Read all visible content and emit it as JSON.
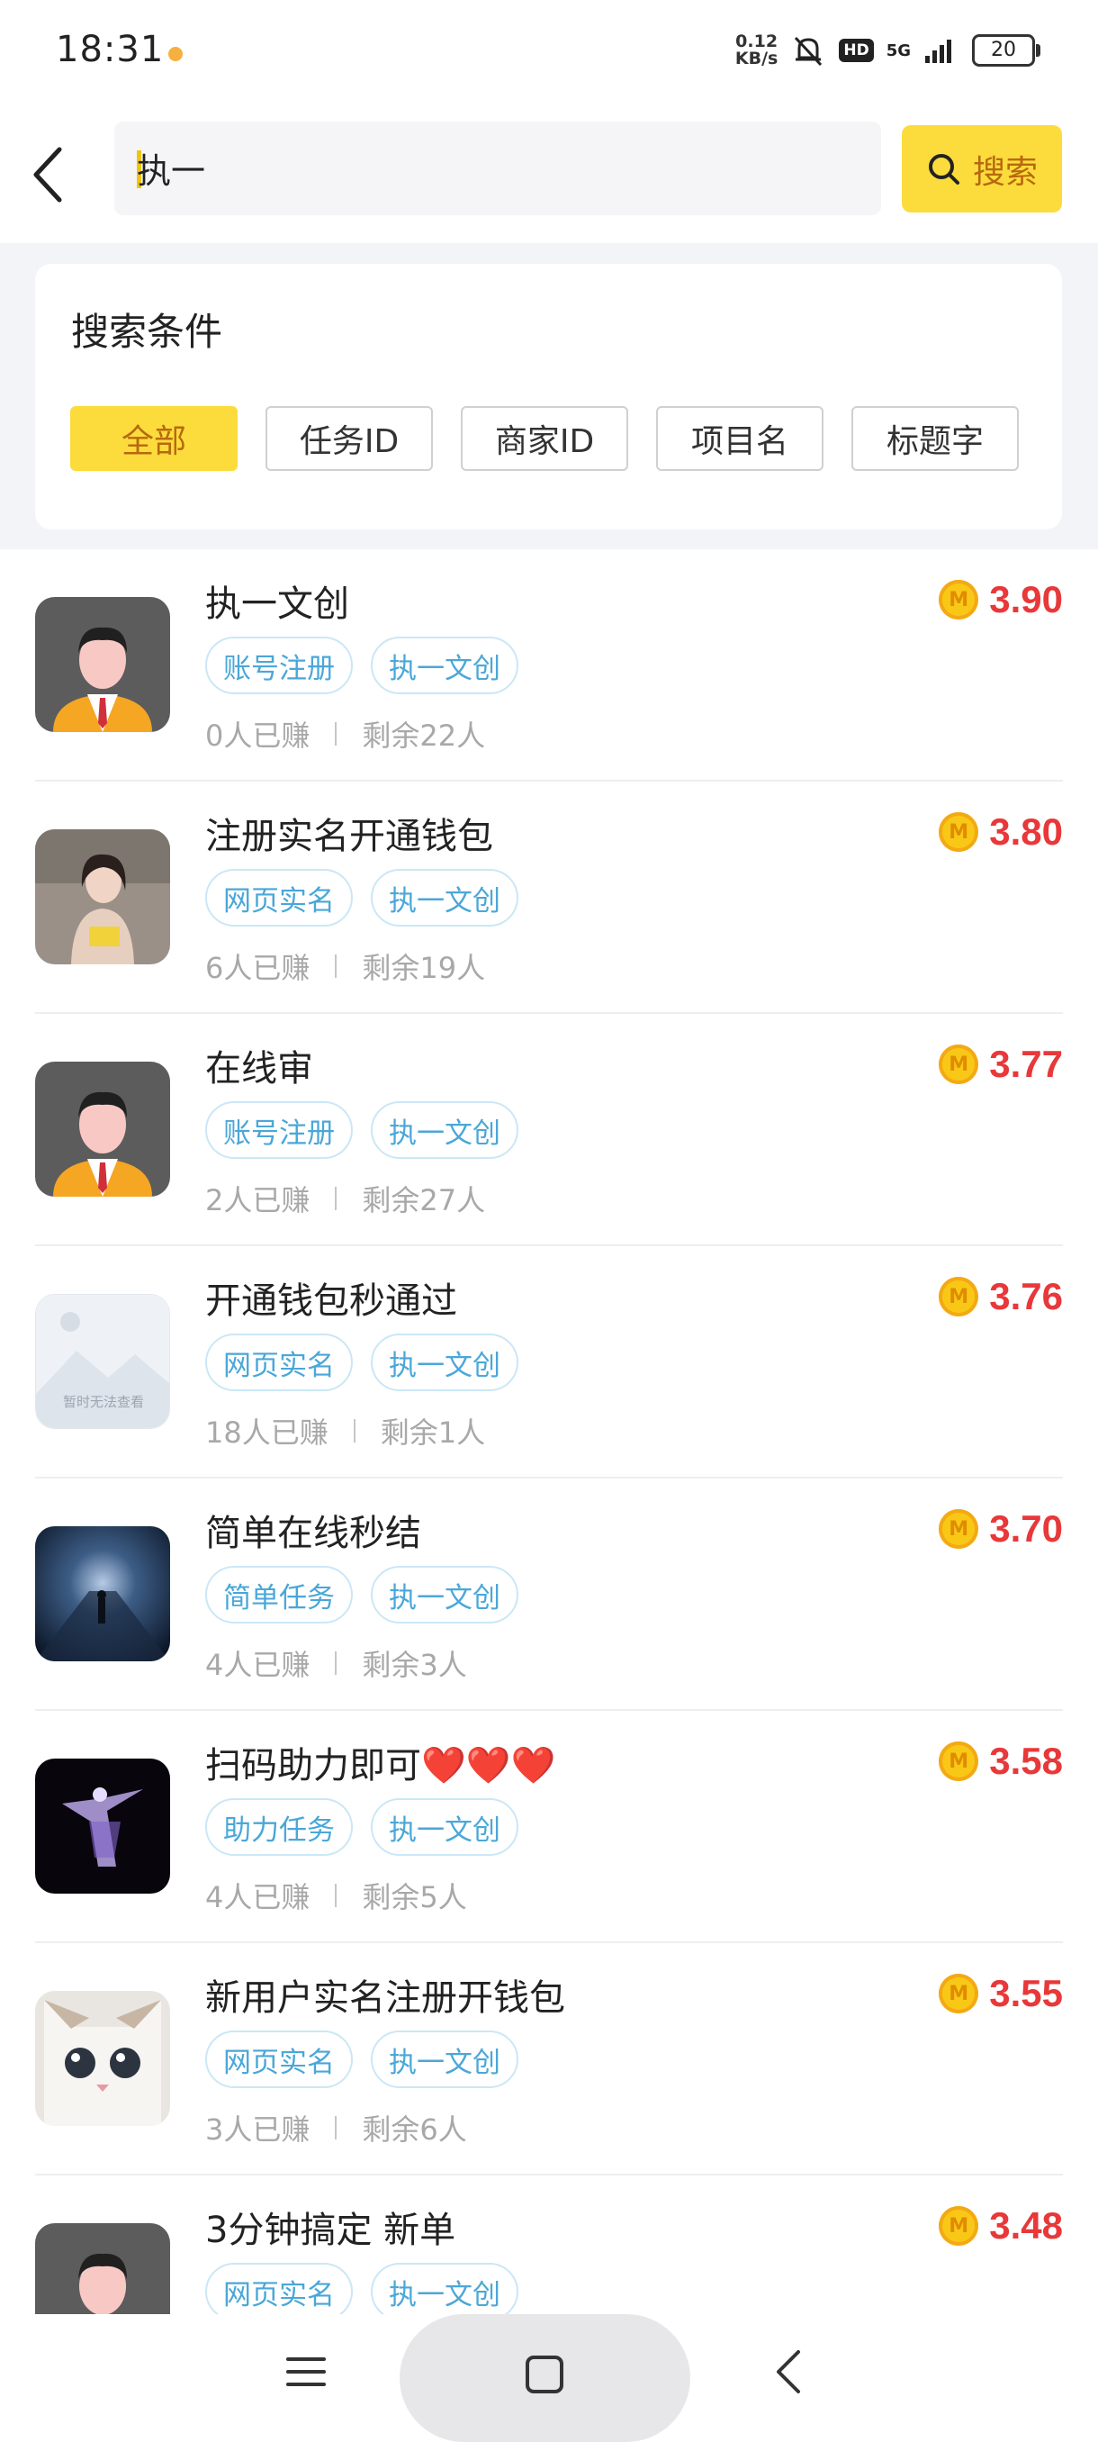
{
  "status_bar": {
    "time": "18:31",
    "speed_top": "0.12",
    "speed_bottom": "KB/s",
    "hd": "HD",
    "network": "5G",
    "battery": "20"
  },
  "search": {
    "query": "执一",
    "button_label": "搜索"
  },
  "filters": {
    "title": "搜索条件",
    "options": [
      "全部",
      "任务ID",
      "商家ID",
      "项目名",
      "标题字"
    ],
    "selected": "全部"
  },
  "tasks": [
    {
      "title": "执一文创",
      "tags": [
        "账号注册",
        "执一文创"
      ],
      "earned": "0人已赚",
      "remaining": "剩余22人",
      "price": "3.90",
      "avatar": "default-avatar"
    },
    {
      "title": "注册实名开通钱包",
      "tags": [
        "网页实名",
        "执一文创"
      ],
      "earned": "6人已赚",
      "remaining": "剩余19人",
      "price": "3.80",
      "avatar": "girl-photo"
    },
    {
      "title": "在线审",
      "tags": [
        "账号注册",
        "执一文创"
      ],
      "earned": "2人已赚",
      "remaining": "剩余27人",
      "price": "3.77",
      "avatar": "default-avatar"
    },
    {
      "title": "开通钱包秒通过",
      "tags": [
        "网页实名",
        "执一文创"
      ],
      "earned": "18人已赚",
      "remaining": "剩余1人",
      "price": "3.76",
      "avatar": "image-unavailable",
      "avatar_caption": "暂时无法查看"
    },
    {
      "title": "简单在线秒结",
      "tags": [
        "简单任务",
        "执一文创"
      ],
      "earned": "4人已赚",
      "remaining": "剩余3人",
      "price": "3.70",
      "avatar": "tunnel-photo"
    },
    {
      "title": "扫码助力即可❤️❤️❤️",
      "tags": [
        "助力任务",
        "执一文创"
      ],
      "earned": "4人已赚",
      "remaining": "剩余5人",
      "price": "3.58",
      "avatar": "neon-figure"
    },
    {
      "title": "新用户实名注册开钱包",
      "tags": [
        "网页实名",
        "执一文创"
      ],
      "earned": "3人已赚",
      "remaining": "剩余6人",
      "price": "3.55",
      "avatar": "cat-photo"
    },
    {
      "title": "3分钟搞定 新单",
      "tags": [
        "网页实名",
        "执一文创"
      ],
      "earned": "",
      "remaining": "",
      "price": "3.48",
      "avatar": "default-avatar"
    }
  ],
  "coin_label": "M",
  "colors": {
    "accent_yellow": "#fbdc3c",
    "accent_text": "#b8680e",
    "price_red": "#e8383a",
    "tag_blue": "#4aa7d8"
  }
}
